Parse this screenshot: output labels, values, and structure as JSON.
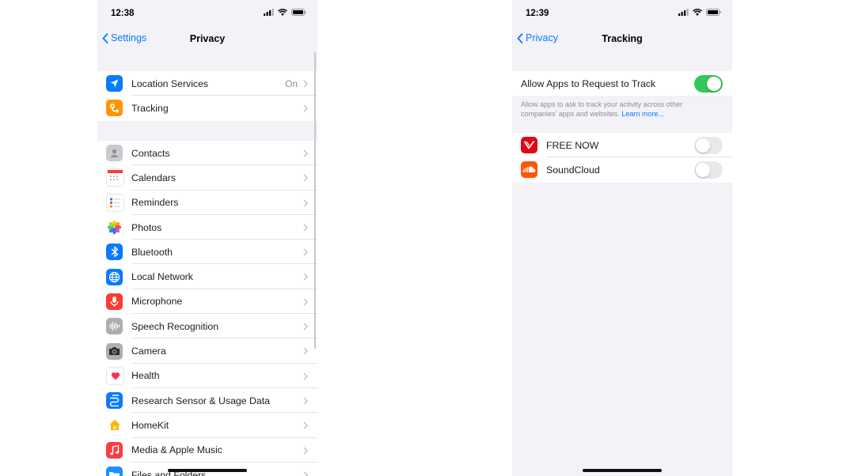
{
  "left": {
    "status": {
      "time": "12:38"
    },
    "nav": {
      "back_label": "Settings",
      "title": "Privacy"
    },
    "top_items": [
      {
        "label": "Location Services",
        "detail": "On",
        "icon": "location-arrow-icon",
        "color": "#0a7aff"
      },
      {
        "label": "Tracking",
        "icon": "tracking-icon",
        "color": "#ff9500"
      }
    ],
    "items": [
      {
        "label": "Contacts",
        "icon": "contacts-icon",
        "color": "#b5b5b5"
      },
      {
        "label": "Calendars",
        "icon": "calendar-icon",
        "color": "#ffffff"
      },
      {
        "label": "Reminders",
        "icon": "reminders-icon",
        "color": "#ffffff"
      },
      {
        "label": "Photos",
        "icon": "photos-icon",
        "color": "#ffffff"
      },
      {
        "label": "Bluetooth",
        "icon": "bluetooth-icon",
        "color": "#0a7aff"
      },
      {
        "label": "Local Network",
        "icon": "globe-icon",
        "color": "#0a7aff"
      },
      {
        "label": "Microphone",
        "icon": "microphone-icon",
        "color": "#ff3b30"
      },
      {
        "label": "Speech Recognition",
        "icon": "waveform-icon",
        "color": "#8e8e93"
      },
      {
        "label": "Camera",
        "icon": "camera-icon",
        "color": "#8e8e93"
      },
      {
        "label": "Health",
        "icon": "heart-icon",
        "color": "#ffffff"
      },
      {
        "label": "Research Sensor & Usage Data",
        "icon": "research-icon",
        "color": "#0a7aff"
      },
      {
        "label": "HomeKit",
        "icon": "home-icon",
        "color": "#ffffff"
      },
      {
        "label": "Media & Apple Music",
        "icon": "music-note-icon",
        "color": "#fc3c44"
      },
      {
        "label": "Files and Folders",
        "icon": "folder-icon",
        "color": "#1e90ff"
      }
    ]
  },
  "right": {
    "status": {
      "time": "12:39"
    },
    "nav": {
      "back_label": "Privacy",
      "title": "Tracking"
    },
    "allow_row": {
      "label": "Allow Apps to Request to Track",
      "enabled": true
    },
    "footnote": {
      "text": "Allow apps to ask to track your activity across other companies' apps and websites.",
      "link": "Learn more..."
    },
    "apps": [
      {
        "label": "FREE NOW",
        "icon": "free-now-icon",
        "color": "#e30613",
        "enabled": false
      },
      {
        "label": "SoundCloud",
        "icon": "soundcloud-icon",
        "color": "#ff5500",
        "enabled": false
      }
    ]
  },
  "colors": {
    "accent": "#0a7aff",
    "toggle_on": "#34c759",
    "background": "#f2f2f7"
  }
}
